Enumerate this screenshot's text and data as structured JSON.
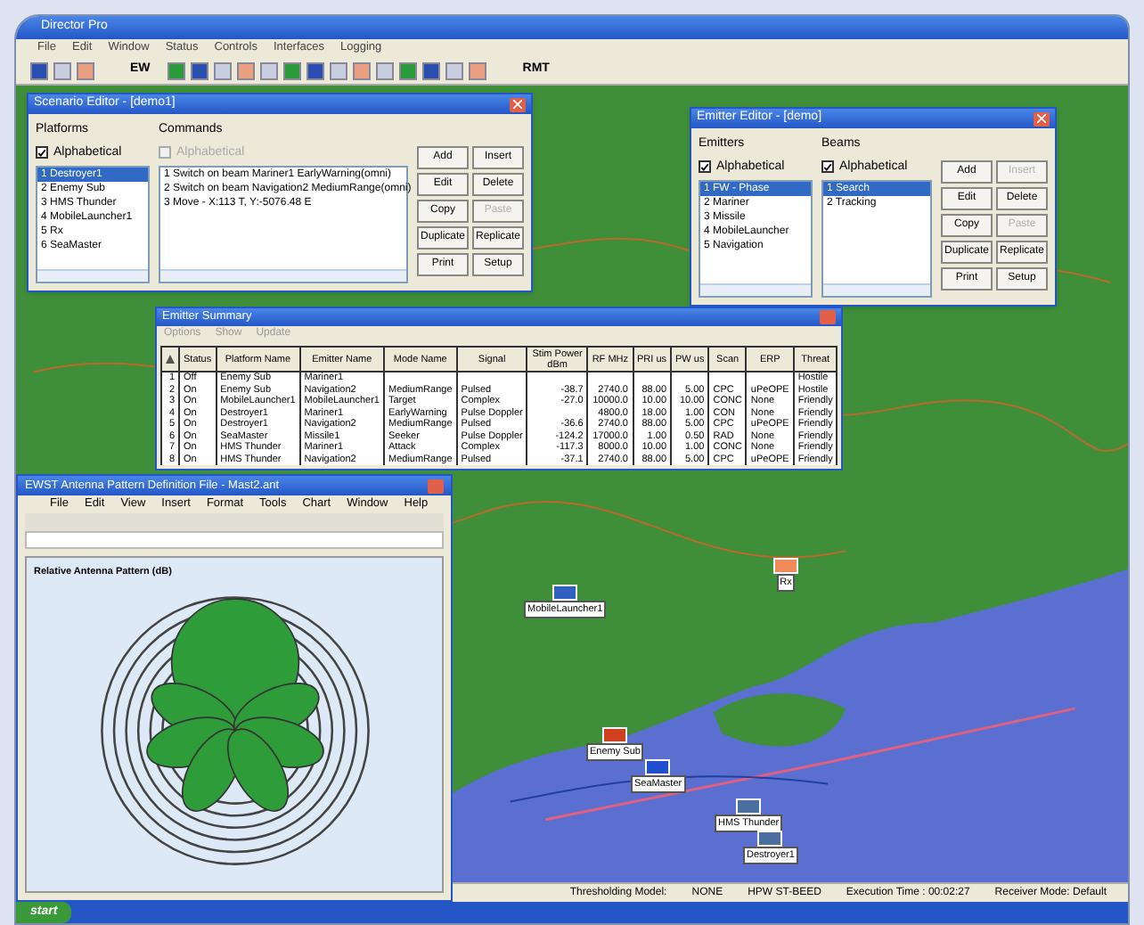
{
  "app": {
    "title": "Director Pro",
    "menu": [
      "File",
      "Edit",
      "Window",
      "Status",
      "Controls",
      "Interfaces",
      "Logging"
    ],
    "toolbar": [
      {
        "kind": "icon"
      },
      {
        "kind": "icon"
      },
      {
        "kind": "icon"
      },
      {
        "kind": "text",
        "label": "EW"
      },
      {
        "kind": "icon"
      },
      {
        "kind": "icon"
      },
      {
        "kind": "icon"
      },
      {
        "kind": "icon"
      },
      {
        "kind": "icon"
      },
      {
        "kind": "icon"
      },
      {
        "kind": "icon"
      },
      {
        "kind": "icon"
      },
      {
        "kind": "icon"
      },
      {
        "kind": "icon"
      },
      {
        "kind": "icon"
      },
      {
        "kind": "icon"
      },
      {
        "kind": "icon"
      },
      {
        "kind": "icon"
      },
      {
        "kind": "text",
        "label": "RMT"
      }
    ]
  },
  "scenario_editor": {
    "title": "Scenario Editor - [demo1]",
    "left": {
      "label": "Platforms",
      "alphabetical": {
        "label": "Alphabetical",
        "checked": true,
        "disabled": false
      },
      "items": [
        {
          "label": "1 Destroyer1",
          "selected": true
        },
        {
          "label": "2 Enemy Sub",
          "selected": false
        },
        {
          "label": "3 HMS Thunder",
          "selected": false
        },
        {
          "label": "4 MobileLauncher1",
          "selected": false
        },
        {
          "label": "5 Rx",
          "selected": false
        },
        {
          "label": "6 SeaMaster",
          "selected": false
        }
      ]
    },
    "right": {
      "label": "Commands",
      "alphabetical": {
        "label": "Alphabetical",
        "checked": false,
        "disabled": true
      },
      "items": [
        {
          "label": "1 Switch on beam Mariner1 EarlyWarning(omni)",
          "selected": false
        },
        {
          "label": "2 Switch on beam Navigation2 MediumRange(omni)",
          "selected": false
        },
        {
          "label": "3 Move - X:113 T, Y:-5076.48 E",
          "selected": false
        }
      ]
    },
    "buttons": [
      {
        "label": "Add",
        "disabled": false
      },
      {
        "label": "Insert",
        "disabled": false
      },
      {
        "label": "Edit",
        "disabled": false
      },
      {
        "label": "Delete",
        "disabled": false
      },
      {
        "label": "Copy",
        "disabled": false
      },
      {
        "label": "Paste",
        "disabled": true
      },
      {
        "label": "Duplicate",
        "disabled": false
      },
      {
        "label": "Replicate",
        "disabled": false
      },
      {
        "label": "Print",
        "disabled": false
      },
      {
        "label": "Setup",
        "disabled": false
      }
    ]
  },
  "emitter_editor": {
    "title": "Emitter Editor - [demo]",
    "left": {
      "label": "Emitters",
      "alphabetical": {
        "label": "Alphabetical",
        "checked": true,
        "disabled": false
      },
      "items": [
        {
          "label": "1 FW - Phase",
          "selected": true
        },
        {
          "label": "2 Mariner",
          "selected": false
        },
        {
          "label": "3 Missile",
          "selected": false
        },
        {
          "label": "4 MobileLauncher",
          "selected": false
        },
        {
          "label": "5 Navigation",
          "selected": false
        }
      ]
    },
    "right": {
      "label": "Beams",
      "alphabetical": {
        "label": "Alphabetical",
        "checked": true,
        "disabled": false
      },
      "items": [
        {
          "label": "1 Search",
          "selected": true
        },
        {
          "label": "2 Tracking",
          "selected": false
        }
      ]
    },
    "buttons": [
      {
        "label": "Add",
        "disabled": false
      },
      {
        "label": "Insert",
        "disabled": true
      },
      {
        "label": "Edit",
        "disabled": false
      },
      {
        "label": "Delete",
        "disabled": false
      },
      {
        "label": "Copy",
        "disabled": false
      },
      {
        "label": "Paste",
        "disabled": true
      },
      {
        "label": "Duplicate",
        "disabled": false
      },
      {
        "label": "Replicate",
        "disabled": false
      },
      {
        "label": "Print",
        "disabled": false
      },
      {
        "label": "Setup",
        "disabled": false
      }
    ]
  },
  "emitter_summary": {
    "title": "Emitter Summary",
    "menu": [
      "Options",
      "Show",
      "Update"
    ],
    "columns": [
      "",
      "Status",
      "Platform Name",
      "Emitter Name",
      "Mode Name",
      "Signal",
      "Stim Power dBm",
      "RF MHz",
      "PRI us",
      "PW us",
      "Scan",
      "ERP",
      "Threat"
    ],
    "rows": [
      [
        "1",
        "Off",
        "Enemy Sub",
        "Mariner1",
        "",
        "",
        "",
        "",
        "",
        "",
        "",
        "",
        "Hostile"
      ],
      [
        "2",
        "On",
        "Enemy Sub",
        "Navigation2",
        "MediumRange",
        "Pulsed",
        "-38.7",
        "2740.0",
        "88.00",
        "5.00",
        "CPC",
        "uPeOPE",
        "Hostile"
      ],
      [
        "3",
        "On",
        "MobileLauncher1",
        "MobileLauncher1",
        "Target",
        "Complex",
        "-27.0",
        "10000.0",
        "10.00",
        "10.00",
        "CONC",
        "None",
        "Friendly"
      ],
      [
        "4",
        "On",
        "Destroyer1",
        "Mariner1",
        "EarlyWarning",
        "Pulse Doppler",
        "",
        "4800.0",
        "18.00",
        "1.00",
        "CON",
        "None",
        "Friendly"
      ],
      [
        "5",
        "On",
        "Destroyer1",
        "Navigation2",
        "MediumRange",
        "Pulsed",
        "-36.6",
        "2740.0",
        "88.00",
        "5.00",
        "CPC",
        "uPeOPE",
        "Friendly"
      ],
      [
        "6",
        "On",
        "SeaMaster",
        "Missile1",
        "Seeker",
        "Pulse Doppler",
        "-124.2",
        "17000.0",
        "1.00",
        "0.50",
        "RAD",
        "None",
        "Friendly"
      ],
      [
        "7",
        "On",
        "HMS Thunder",
        "Mariner1",
        "Attack",
        "Complex",
        "-117.3",
        "8000.0",
        "10.00",
        "1.00",
        "CONC",
        "None",
        "Friendly"
      ],
      [
        "8",
        "On",
        "HMS Thunder",
        "Navigation2",
        "MediumRange",
        "Pulsed",
        "-37.1",
        "2740.0",
        "88.00",
        "5.00",
        "CPC",
        "uPeOPE",
        "Friendly"
      ]
    ]
  },
  "antenna_window": {
    "title": "EWST Antenna Pattern Definition File - Mast2.ant",
    "menu": [
      "File",
      "Edit",
      "View",
      "Insert",
      "Format",
      "Tools",
      "Chart",
      "Window",
      "Help"
    ],
    "chart_title": "Relative Antenna Pattern (dB)"
  },
  "map": {
    "labels": [
      {
        "text": "Rx",
        "kind": "site"
      },
      {
        "text": "MobileLauncher1",
        "kind": "launcher"
      },
      {
        "text": "Enemy Sub",
        "kind": "sub"
      },
      {
        "text": "SeaMaster",
        "kind": "missile"
      },
      {
        "text": "HMS Thunder",
        "kind": "ship"
      },
      {
        "text": "Destroyer1",
        "kind": "ship"
      }
    ]
  },
  "status_bar": [
    "Thresholding Model:",
    "NONE",
    "HPW ST-BEED",
    "Execution Time : 00:02:27",
    "Receiver Mode: Default"
  ],
  "taskbar": {
    "start": "start"
  }
}
